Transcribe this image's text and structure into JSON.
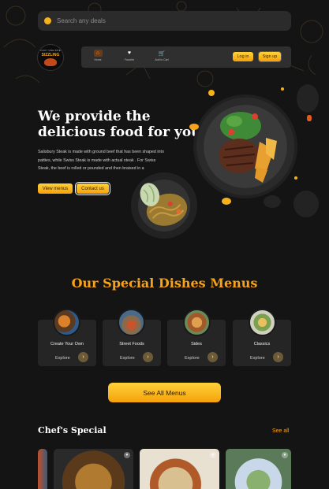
{
  "search": {
    "placeholder": "Search any deals"
  },
  "logo": {
    "line1": "JUICY ONE BITE",
    "line2": "SIZZLING"
  },
  "nav": {
    "items": [
      {
        "label": "Home",
        "icon": "home-icon"
      },
      {
        "label": "Favorite",
        "icon": "heart-icon"
      },
      {
        "label": "Add to Cart",
        "icon": "cart-icon"
      }
    ],
    "login": "Log in",
    "signup": "Sign up"
  },
  "hero": {
    "title_line1": "We provide the",
    "title_line2": "delicious food for you",
    "text": "Salisbury Steak is made with ground beef that has been shaped into patties, while Swiss Steak is made with actual steak . For Swiss Steak, the beef is rolled or pounded and then braised in a",
    "view_menus": "View menus",
    "contact_us": "Contact us"
  },
  "special": {
    "title": "Our Special Dishes Menus",
    "categories": [
      {
        "name": "Create Your Own",
        "explore": "Explore"
      },
      {
        "name": "Street Foods",
        "explore": "Explore"
      },
      {
        "name": "Sides",
        "explore": "Explore"
      },
      {
        "name": "Classics",
        "explore": "Explore"
      }
    ],
    "see_all_menus": "See All Menus"
  },
  "chefs": {
    "title": "Chef's Special",
    "see_all": "See all"
  },
  "colors": {
    "accent": "#f6a21a",
    "background": "#141414",
    "card": "#252525"
  }
}
